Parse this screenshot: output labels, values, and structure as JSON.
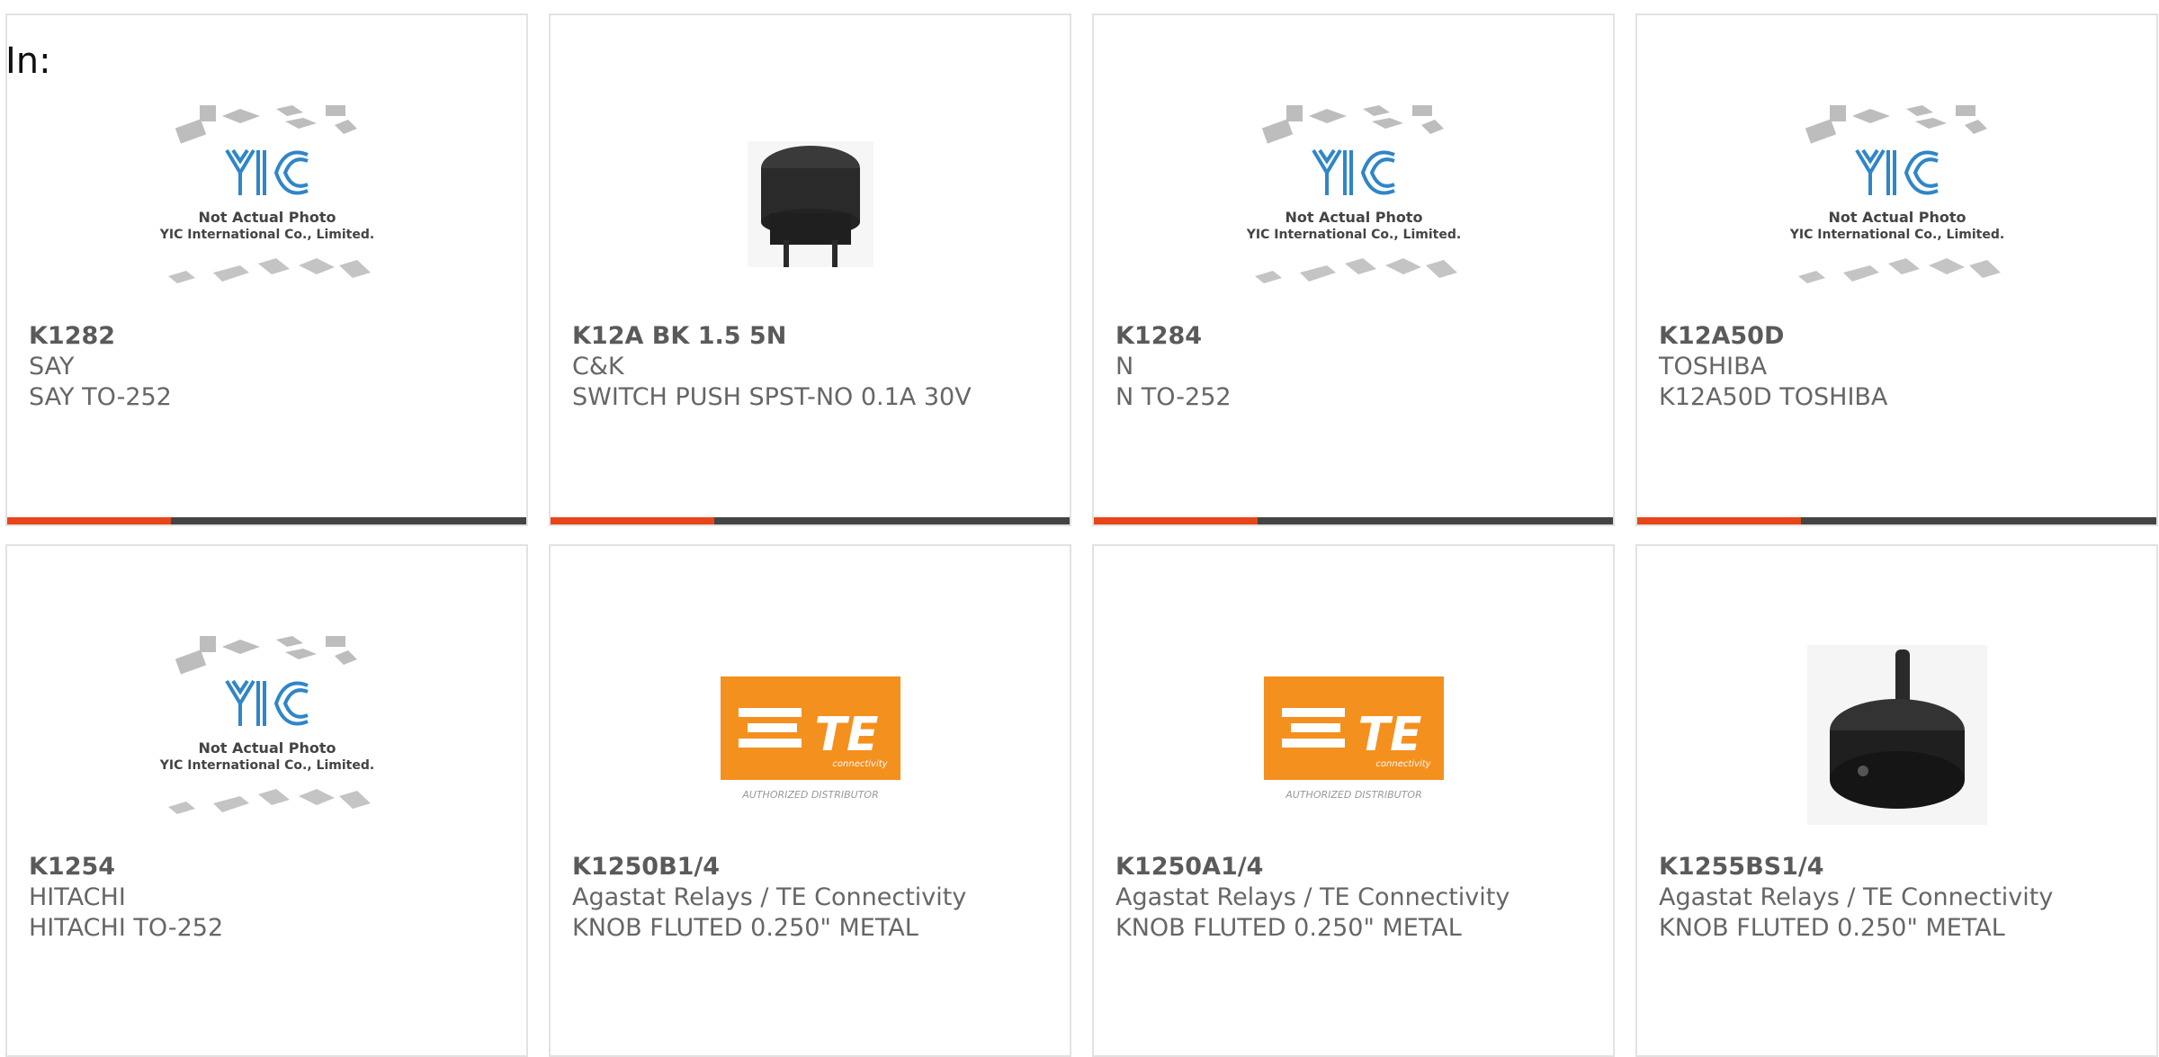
{
  "label_in": "In:",
  "colors": {
    "accent": "#e84519",
    "bar": "#444444",
    "te_orange": "#f4901e",
    "yic_blue": "#2f86c8"
  },
  "placeholder": {
    "line1": "Not Actual Photo",
    "line2": "YIC International Co., Limited.",
    "logo_text": "YIC"
  },
  "te": {
    "brand": "TE",
    "sub": "connectivity",
    "tagline": "AUTHORIZED DISTRIBUTOR"
  },
  "products": [
    {
      "part": "K1282",
      "brand": "SAY",
      "desc": "SAY TO-252",
      "image": "yic-placeholder"
    },
    {
      "part": "K12A BK 1.5 5N",
      "brand": "C&K",
      "desc": "SWITCH PUSH SPST-NO 0.1A 30V",
      "image": "push-switch"
    },
    {
      "part": "K1284",
      "brand": "N",
      "desc": "N TO-252",
      "image": "yic-placeholder"
    },
    {
      "part": "K12A50D",
      "brand": "TOSHIBA",
      "desc": "K12A50D TOSHIBA",
      "image": "yic-placeholder"
    },
    {
      "part": "K1254",
      "brand": "HITACHI",
      "desc": "HITACHI TO-252",
      "image": "yic-placeholder"
    },
    {
      "part": "K1250B1/4",
      "brand": "Agastat Relays / TE Connectivity",
      "desc": "KNOB FLUTED 0.250\" METAL",
      "image": "te-logo"
    },
    {
      "part": "K1250A1/4",
      "brand": "Agastat Relays / TE Connectivity",
      "desc": "KNOB FLUTED 0.250\" METAL",
      "image": "te-logo"
    },
    {
      "part": "K1255BS1/4",
      "brand": "Agastat Relays / TE Connectivity",
      "desc": "KNOB FLUTED 0.250\" METAL",
      "image": "knob"
    }
  ]
}
